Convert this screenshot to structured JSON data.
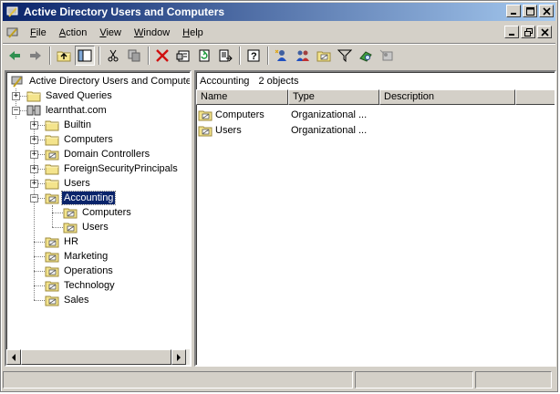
{
  "window": {
    "title": "Active Directory Users and Computers",
    "icon": "aduc-console-icon",
    "controls": [
      "_",
      "□",
      "×"
    ]
  },
  "menu": {
    "items": [
      {
        "label": "File",
        "underline": "F",
        "rest": "ile"
      },
      {
        "label": "Action",
        "underline": "A",
        "rest": "ction"
      },
      {
        "label": "View",
        "underline": "V",
        "rest": "iew"
      },
      {
        "label": "Window",
        "underline": "W",
        "rest": "indow"
      },
      {
        "label": "Help",
        "underline": "H",
        "rest": "elp"
      }
    ],
    "mdi_controls": [
      "_",
      "▫",
      "×"
    ]
  },
  "toolbar": {
    "icons": [
      "back-arrow-icon",
      "forward-arrow-icon",
      "up-folder-icon",
      "show-hide-tree-icon",
      "cut-icon",
      "copy-icon",
      "delete-icon",
      "properties-icon",
      "refresh-icon",
      "export-list-icon",
      "help-icon",
      "new-user-icon",
      "new-group-icon",
      "new-ou-icon",
      "filter-icon",
      "find-icon",
      "add-to-group-icon"
    ]
  },
  "tree": {
    "root": "Active Directory Users and Computer",
    "saved_queries": "Saved Queries",
    "domain": "learnthat.com",
    "children": [
      "Builtin",
      "Computers",
      "Domain Controllers",
      "ForeignSecurityPrincipals",
      "Users"
    ],
    "selected": "Accounting",
    "accounting_children": [
      "Computers",
      "Users"
    ],
    "other_ous": [
      "HR",
      "Marketing",
      "Operations",
      "Technology",
      "Sales"
    ]
  },
  "details": {
    "container": "Accounting",
    "count": "2 objects",
    "columns": [
      "Name",
      "Type",
      "Description"
    ],
    "rows": [
      {
        "name": "Computers",
        "type": "Organizational ...",
        "description": ""
      },
      {
        "name": "Users",
        "type": "Organizational ...",
        "description": ""
      }
    ]
  },
  "colors": {
    "title_start": "#0a246a",
    "title_end": "#a6caf0",
    "selection": "#0a246a",
    "chrome": "#d4d0c8"
  }
}
